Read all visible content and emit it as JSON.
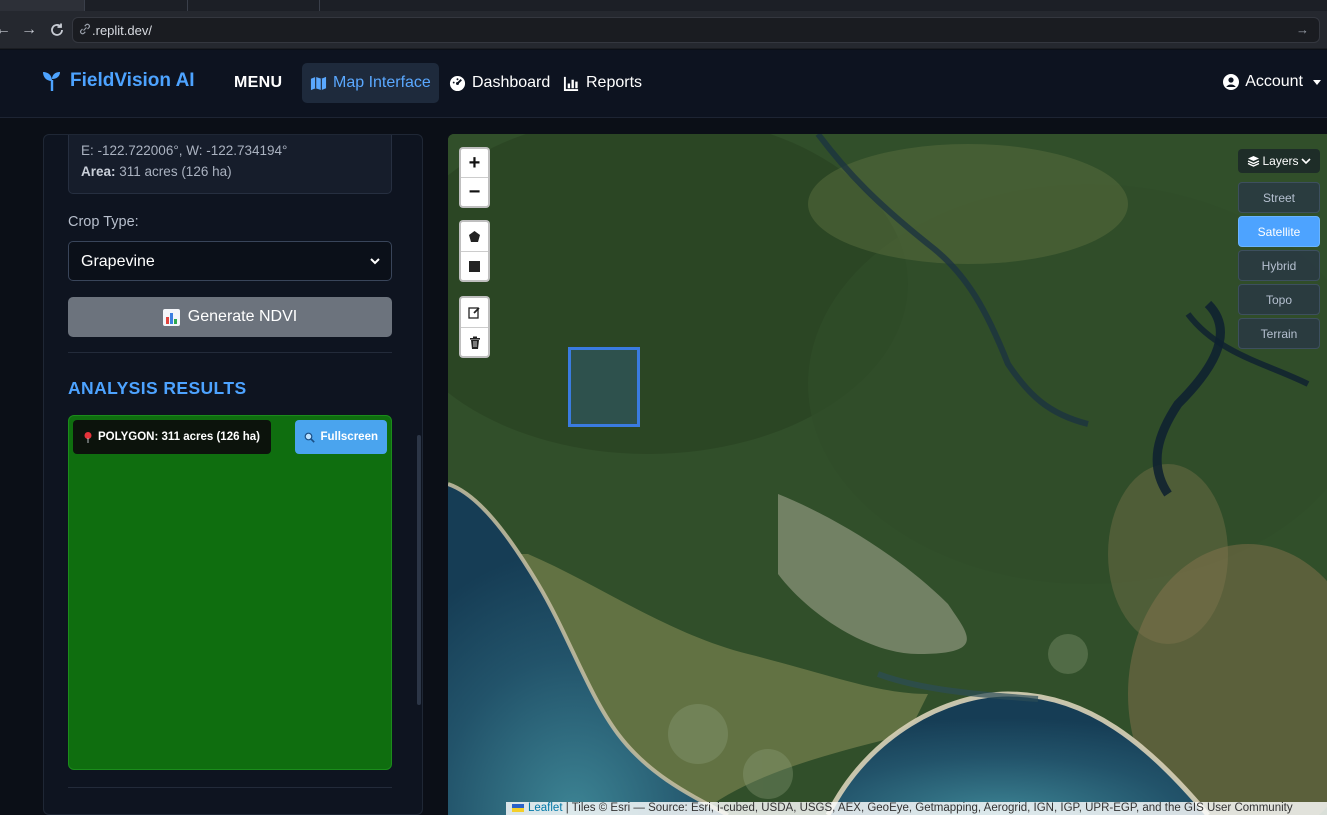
{
  "browser": {
    "url": ".replit.dev/"
  },
  "app": {
    "brand": "FieldVision AI",
    "menu_label": "MENU",
    "nav": [
      {
        "label": "Map Interface",
        "active": true,
        "icon": "map-icon"
      },
      {
        "label": "Dashboard",
        "active": false,
        "icon": "dashboard-gauge-icon"
      },
      {
        "label": "Reports",
        "active": false,
        "icon": "bar-chart-icon"
      }
    ],
    "account_label": "Account"
  },
  "sidebar": {
    "coords_line": "E: -122.722006°, W: -122.734194°",
    "area_label": "Area:",
    "area_value": "311 acres (126 ha)",
    "crop_label": "Crop Type:",
    "crop_value": "Grapevine",
    "generate_label": "Generate NDVI",
    "results_heading": "ANALYSIS RESULTS",
    "polygon_tag": "POLYGON: 311 acres (126 ha)",
    "fullscreen_label": "Fullscreen",
    "result_color": "#0f6e0f"
  },
  "map": {
    "zoom_in": "+",
    "zoom_out": "−",
    "layers_label": "Layers",
    "layer_options": [
      {
        "label": "Street",
        "active": false
      },
      {
        "label": "Satellite",
        "active": true
      },
      {
        "label": "Hybrid",
        "active": false
      },
      {
        "label": "Topo",
        "active": false
      },
      {
        "label": "Terrain",
        "active": false
      }
    ],
    "attribution_link": "Leaflet",
    "attribution_text": " | Tiles © Esri — Source: Esri, i-cubed, USDA, USGS, AEX, GeoEye, Getmapping, Aerogrid, IGN, IGP, UPR-EGP, and the GIS User Community"
  },
  "colors": {
    "accent": "#4da3ff",
    "nav_bg": "#0d1320",
    "button_gray": "#6c737d"
  }
}
